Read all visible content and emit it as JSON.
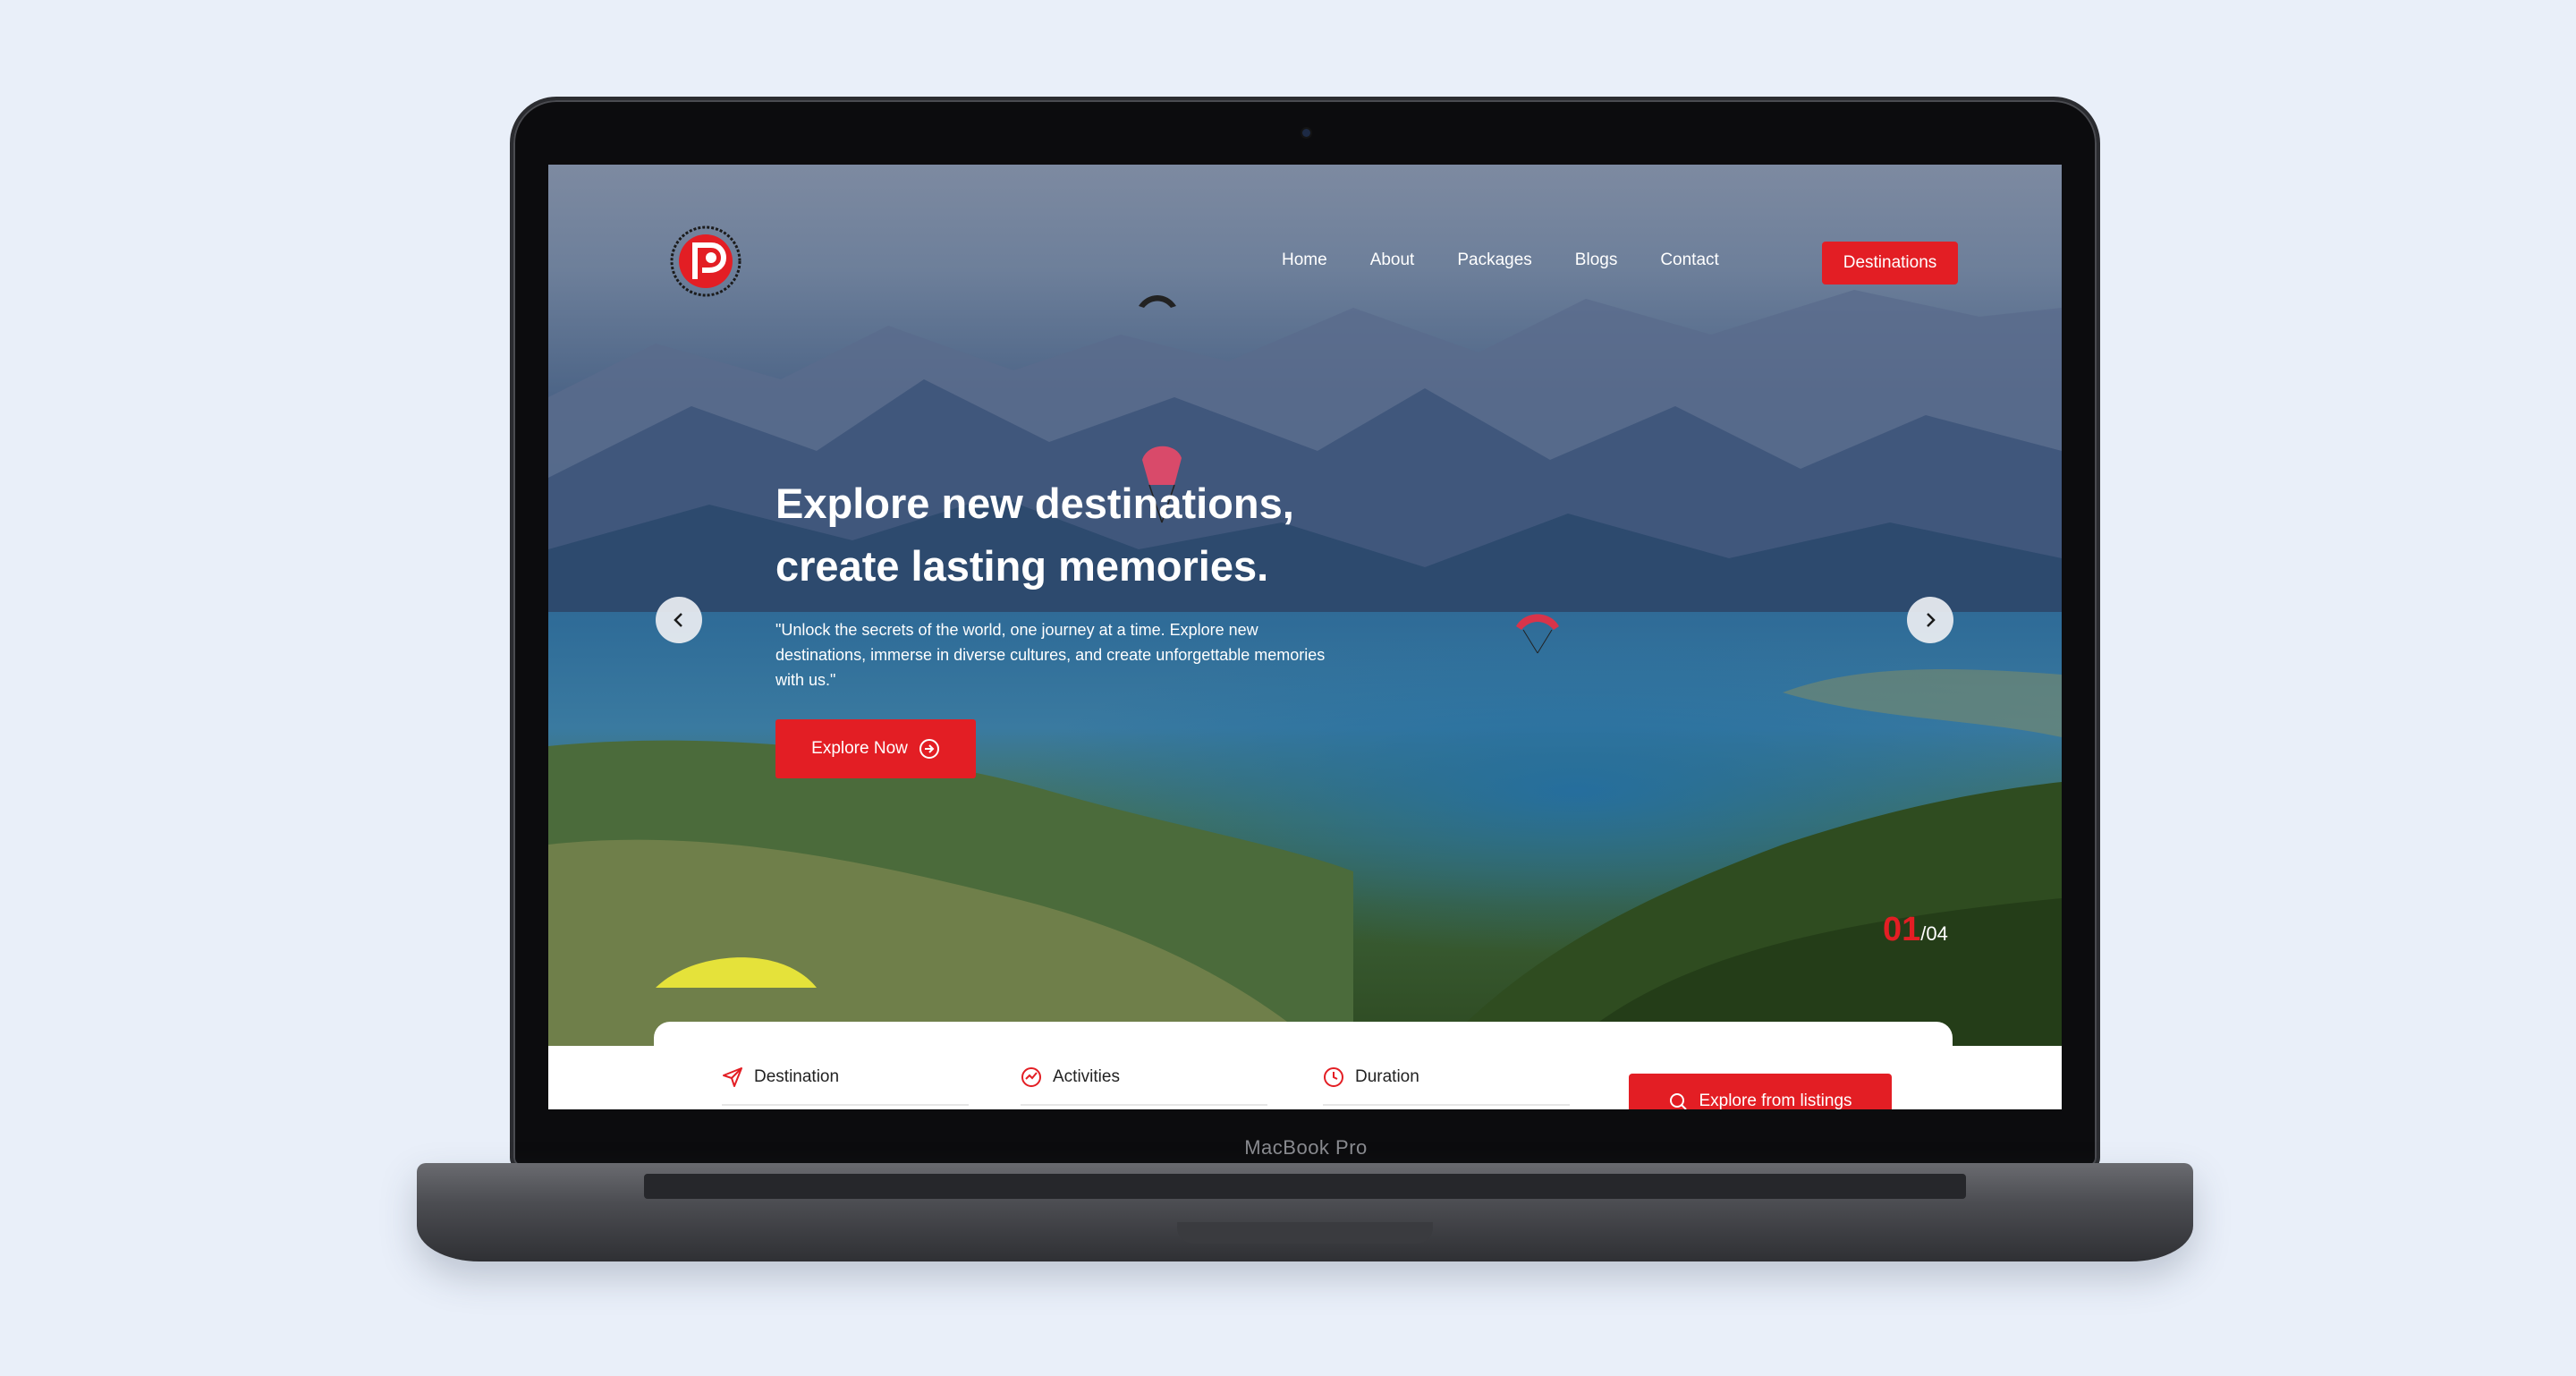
{
  "device": {
    "label": "MacBook Pro"
  },
  "nav": {
    "items": [
      {
        "label": "Home"
      },
      {
        "label": "About"
      },
      {
        "label": "Packages"
      },
      {
        "label": "Blogs"
      },
      {
        "label": "Contact"
      }
    ],
    "cta_label": "Destinations"
  },
  "hero": {
    "title_line1": "Explore new destinations,",
    "title_line2": "create lasting memories.",
    "subtitle": "\"Unlock the secrets of the world, one journey at a time. Explore new destinations, immerse in diverse cultures, and create unforgettable memories with us.\"",
    "button_label": "Explore Now",
    "slide_current": "01",
    "slide_total": "/04"
  },
  "search": {
    "destination_label": "Destination",
    "activities_label": "Activities",
    "duration_label": "Duration",
    "button_label": "Explore from listings"
  },
  "colors": {
    "accent": "#e31e24",
    "page_bg": "#e9eff9"
  },
  "icons": {
    "logo": "brand-logo-icon",
    "prev": "chevron-left-icon",
    "next": "chevron-right-icon",
    "destination": "send-icon",
    "activities": "activity-icon",
    "duration": "clock-icon",
    "search": "search-icon",
    "explore": "arrow-circle-right-icon"
  }
}
